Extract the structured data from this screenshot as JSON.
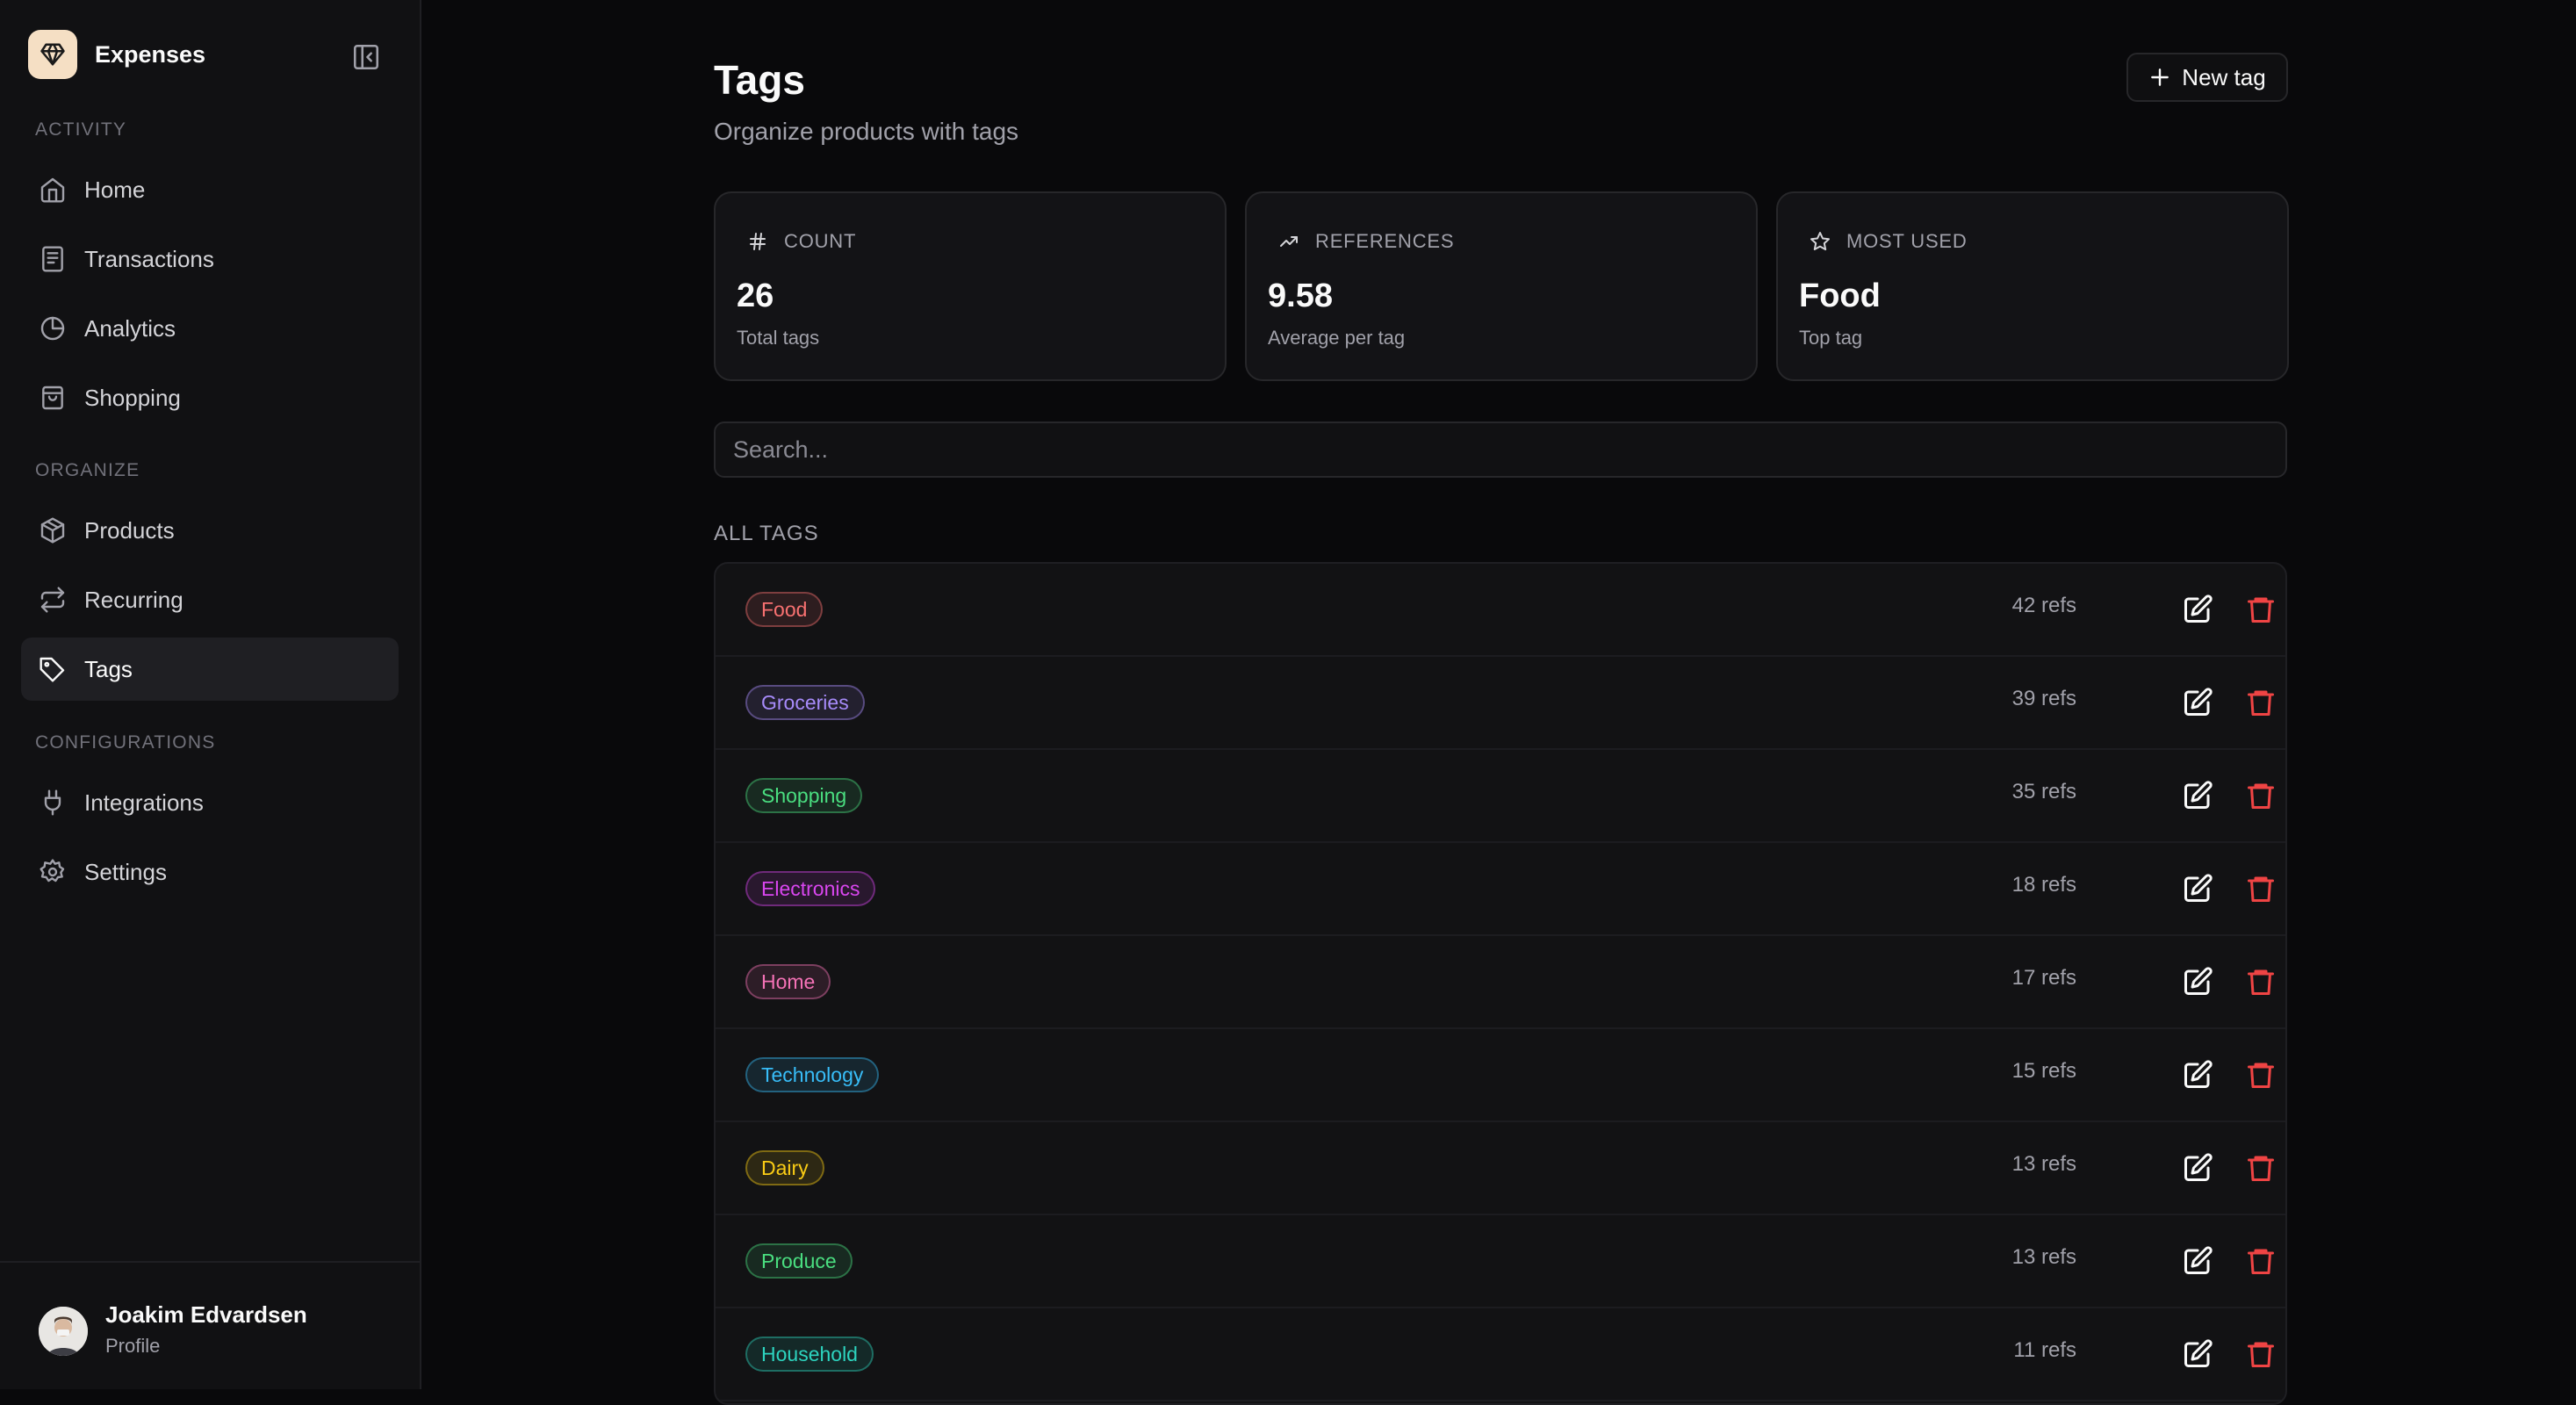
{
  "app": {
    "name": "Expenses"
  },
  "sidebar": {
    "sections": [
      {
        "title": "Activity"
      },
      {
        "title": "Organize"
      },
      {
        "title": "Configurations"
      }
    ],
    "items": [
      {
        "label": "Home",
        "icon": "home-icon"
      },
      {
        "label": "Transactions",
        "icon": "receipt-icon"
      },
      {
        "label": "Analytics",
        "icon": "pie-chart-icon"
      },
      {
        "label": "Shopping",
        "icon": "shopping-bag-icon"
      },
      {
        "label": "Products",
        "icon": "package-icon"
      },
      {
        "label": "Recurring",
        "icon": "repeat-icon"
      },
      {
        "label": "Tags",
        "icon": "tag-icon",
        "active": true
      },
      {
        "label": "Integrations",
        "icon": "plug-icon"
      },
      {
        "label": "Settings",
        "icon": "gear-icon"
      }
    ]
  },
  "profile": {
    "name": "Joakim Edvardsen",
    "subtitle": "Profile"
  },
  "header": {
    "title": "Tags",
    "subtitle": "Organize products with tags",
    "new_button": "New tag"
  },
  "stats": [
    {
      "label": "COUNT",
      "icon": "hash-icon",
      "value": "26",
      "caption": "Total tags"
    },
    {
      "label": "REFERENCES",
      "icon": "trending-up-icon",
      "value": "9.58",
      "caption": "Average per tag"
    },
    {
      "label": "MOST USED",
      "icon": "star-icon",
      "value": "Food",
      "caption": "Top tag"
    }
  ],
  "search": {
    "placeholder": "Search..."
  },
  "list": {
    "title": "ALL TAGS",
    "rows": [
      {
        "name": "Food",
        "refs": "42 refs",
        "color": "#f87171"
      },
      {
        "name": "Groceries",
        "refs": "39 refs",
        "color": "#a78bfa"
      },
      {
        "name": "Shopping",
        "refs": "35 refs",
        "color": "#4ade80"
      },
      {
        "name": "Electronics",
        "refs": "18 refs",
        "color": "#d946ef"
      },
      {
        "name": "Home",
        "refs": "17 refs",
        "color": "#f472b6"
      },
      {
        "name": "Technology",
        "refs": "15 refs",
        "color": "#38bdf8"
      },
      {
        "name": "Dairy",
        "refs": "13 refs",
        "color": "#facc15"
      },
      {
        "name": "Produce",
        "refs": "13 refs",
        "color": "#4ade80"
      },
      {
        "name": "Household",
        "refs": "11 refs",
        "color": "#2dd4bf"
      }
    ]
  },
  "colors": {
    "background": "#09090b",
    "sidebar": "#111113",
    "danger": "#ef4444"
  }
}
